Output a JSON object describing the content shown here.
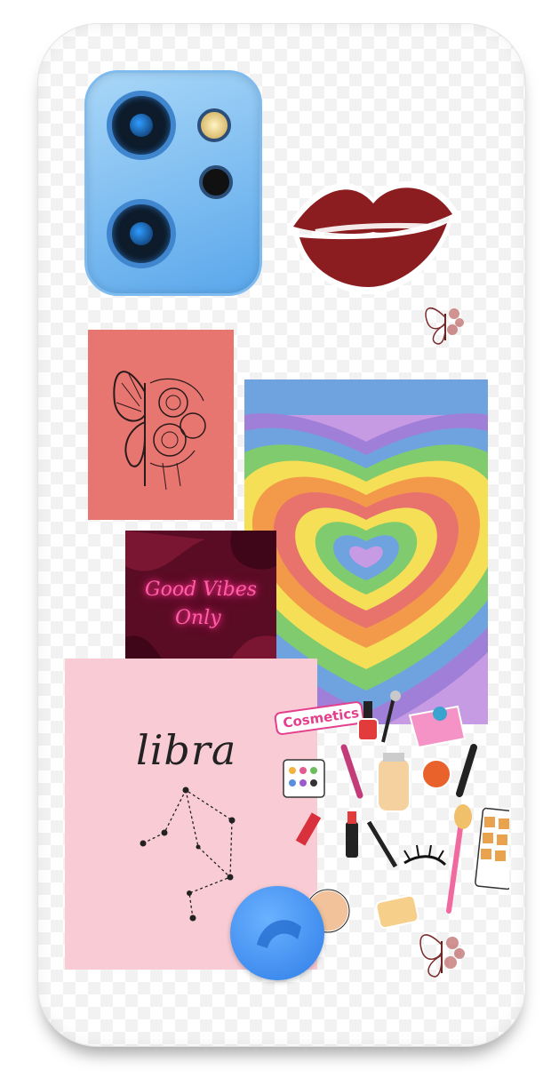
{
  "product": {
    "type": "phone case",
    "camera_color": "#74b6f2",
    "case_color": "#ffffff"
  },
  "stickers": {
    "lips": {
      "icon": "lips-icon",
      "color": "#8b1c1f"
    },
    "butterfly_small_top": {
      "icon": "butterfly-icon"
    },
    "butterfly_small_bottom": {
      "icon": "butterfly-icon"
    },
    "coral_card": {
      "icon": "butterfly-flower-sketch-icon",
      "color": "#e77570"
    },
    "rainbow_heart": {
      "icon": "rainbow-heart-icon",
      "colors": [
        "#e7736c",
        "#f39a4a",
        "#f5df57",
        "#7fcb6d",
        "#6fa3e0",
        "#a07fd8",
        "#c79be3"
      ]
    },
    "neon_card": {
      "line1": "Good Vibes",
      "line2": "Only",
      "color": "#ff5fa8"
    },
    "libra_card": {
      "title": "libra",
      "icon": "libra-constellation-icon",
      "color": "#f9ccd5"
    },
    "cosmetics": {
      "label": "Cosmetics",
      "icon": "cosmetics-collage-icon"
    },
    "blue_button": {
      "icon": "blue-circle-icon",
      "color": "#3b8af0"
    }
  }
}
